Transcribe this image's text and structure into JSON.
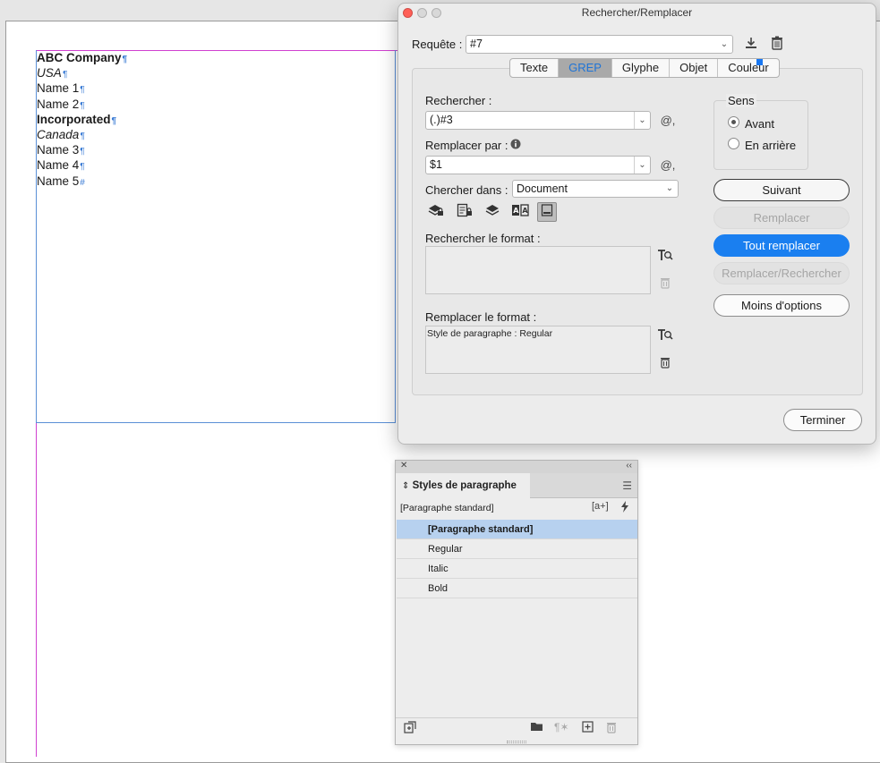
{
  "document": {
    "lines": [
      {
        "text": "ABC Company",
        "mark": "¶",
        "style": "bold"
      },
      {
        "text": "USA",
        "mark": "¶",
        "style": "italic"
      },
      {
        "text": "Name 1",
        "mark": "¶",
        "style": "regular"
      },
      {
        "text": "Name 2",
        "mark": "¶",
        "style": "regular"
      },
      {
        "text": "Incorporated",
        "mark": "¶",
        "style": "bold"
      },
      {
        "text": "Canada",
        "mark": "¶",
        "style": "italic"
      },
      {
        "text": "Name 3",
        "mark": "¶",
        "style": "regular"
      },
      {
        "text": "Name 4",
        "mark": "¶",
        "style": "regular"
      },
      {
        "text": "Name 5",
        "mark": "#",
        "style": "regular"
      }
    ]
  },
  "dialog": {
    "title": "Rechercher/Remplacer",
    "query_label": "Requête :",
    "query_value": "#7",
    "tabs": [
      "Texte",
      "GREP",
      "Glyphe",
      "Objet",
      "Couleur"
    ],
    "active_tab": "GREP",
    "find_label": "Rechercher :",
    "find_value": "(.)#3",
    "replace_label": "Remplacer par :",
    "replace_value": "$1",
    "search_in_label": "Chercher dans :",
    "search_in_value": "Document",
    "find_format_label": "Rechercher le format :",
    "find_format_value": "",
    "replace_format_label": "Remplacer le format :",
    "replace_format_value": "Style de paragraphe : Regular",
    "direction_label": "Sens",
    "direction_forward": "Avant",
    "direction_backward": "En arrière",
    "special_char_icon": "@,",
    "buttons": {
      "next": "Suivant",
      "replace": "Remplacer",
      "replace_all": "Tout remplacer",
      "replace_find": "Remplacer/Rechercher",
      "fewer_options": "Moins d'options",
      "done": "Terminer"
    },
    "colors": {
      "accent": "#1a7ff0",
      "tab_active_text": "#1f74d6"
    }
  },
  "panel": {
    "title": "Styles de paragraphe",
    "current_style": "[Paragraphe standard]",
    "styles": [
      "[Paragraphe standard]",
      "Regular",
      "Italic",
      "Bold"
    ],
    "selected_style": "[Paragraphe standard]",
    "new_style_icon": "[a+]"
  }
}
